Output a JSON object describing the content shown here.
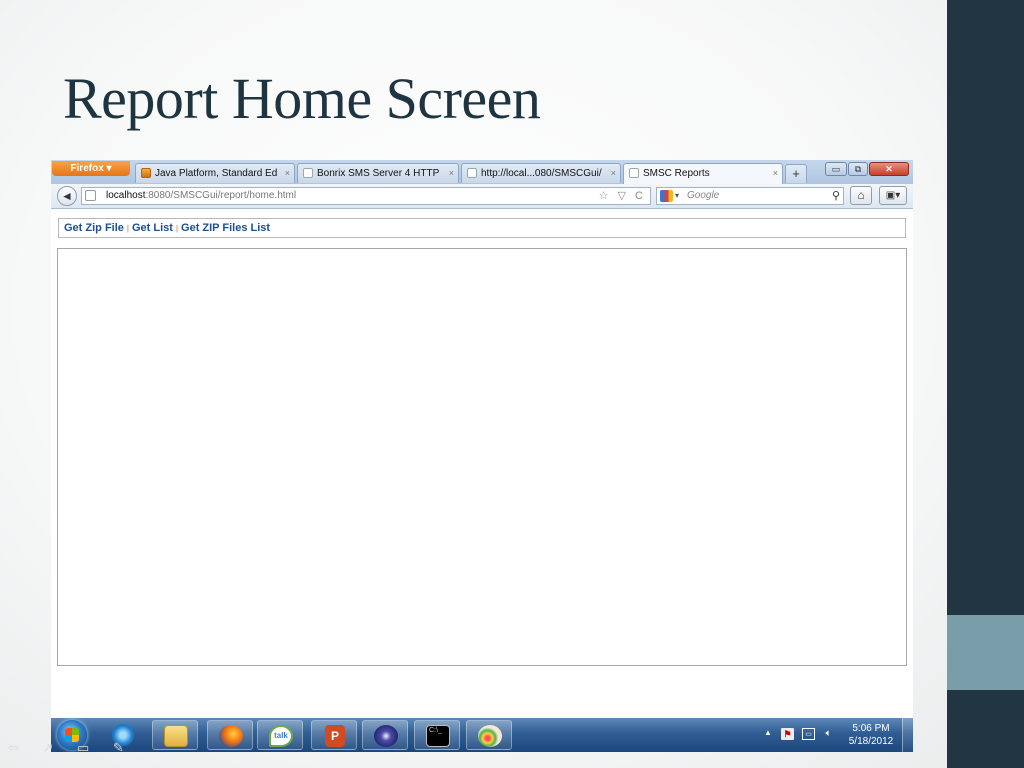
{
  "slide": {
    "title": "Report Home Screen",
    "colors": {
      "sidebar": "#213642",
      "sidebar_accent": "#7a9ea9",
      "title": "#1f3441"
    }
  },
  "browser": {
    "menu_button": "Firefox ▾",
    "tabs": [
      {
        "label": "Java Platform, Standard Ed...",
        "icon": "java-doc-icon",
        "active": false
      },
      {
        "label": "Bonrix SMS Server 4 HTTP ...",
        "icon": "page-icon",
        "active": false
      },
      {
        "label": "http://local...080/SMSCGui/",
        "icon": "page-icon",
        "active": false
      },
      {
        "label": "SMSC Reports",
        "icon": "page-icon",
        "active": true
      }
    ],
    "tab_close_glyph": "×",
    "new_tab_glyph": "+",
    "window_controls": {
      "minimize": "▭",
      "restore": "⧉",
      "close": "✕"
    },
    "url": {
      "host": "localhost",
      "rest": ":8080/SMSCGui/report/home.html"
    },
    "url_tools": "☆ ▽ C",
    "search": {
      "placeholder": "Google",
      "engine_icon": "google-icon"
    },
    "back_glyph": "◄",
    "home_glyph": "⌂",
    "addon_glyph": "▣▾"
  },
  "page": {
    "links": [
      "Get Zip File",
      "Get List",
      "Get ZIP Files List"
    ],
    "separator": "|"
  },
  "taskbar": {
    "apps": [
      "internet-explorer",
      "windows-explorer",
      "firefox",
      "google-talk",
      "powerpoint",
      "eclipse",
      "command-prompt",
      "paint"
    ],
    "talk_label": "talk",
    "ppt_label": "P",
    "cmd_label": "C:\\_",
    "tray_up": "▲",
    "clock_time": "5:06 PM",
    "clock_date": "5/18/2012"
  },
  "slide_nav": "⇦ ↗ ▭ ✎"
}
